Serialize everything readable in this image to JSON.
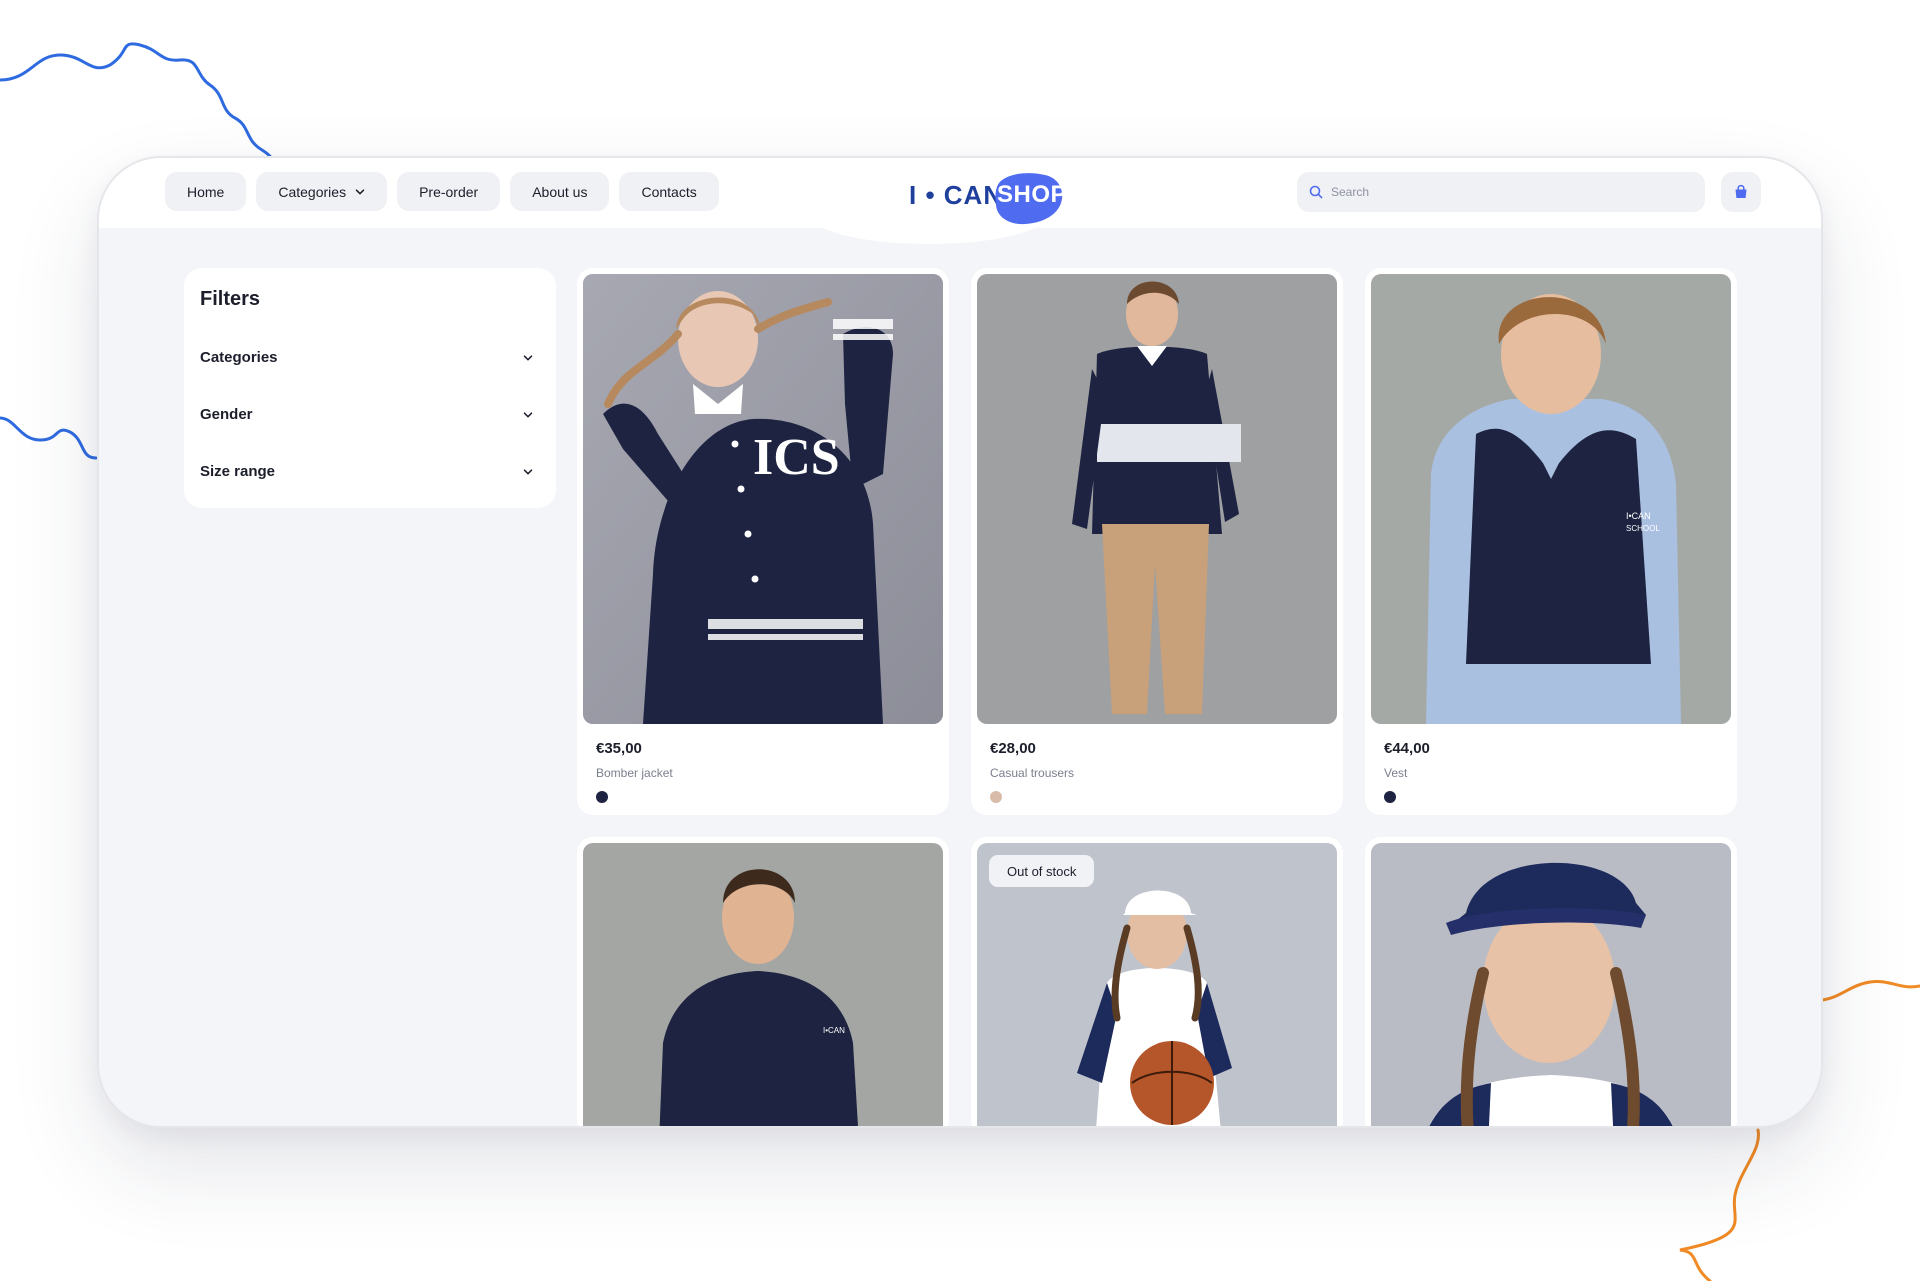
{
  "nav": {
    "home": "Home",
    "categories": "Categories",
    "preorder": "Pre-order",
    "about": "About us",
    "contacts": "Contacts"
  },
  "logo": {
    "left": "I • CAN",
    "right": "SHOP"
  },
  "search": {
    "placeholder": "Search",
    "value": ""
  },
  "filters": {
    "title": "Filters",
    "items": [
      {
        "label": "Categories"
      },
      {
        "label": "Gender"
      },
      {
        "label": "Size range"
      }
    ]
  },
  "products": [
    {
      "price": "€35,00",
      "name": "Bomber jacket",
      "color": "#1d2341"
    },
    {
      "price": "€28,00",
      "name": "Casual trousers",
      "color": "#d9bcaa"
    },
    {
      "price": "€44,00",
      "name": "Vest",
      "color": "#1d2341"
    },
    {
      "badge": ""
    },
    {
      "badge": "Out of stock"
    },
    {
      "badge": ""
    }
  ],
  "colors": {
    "accent": "#4f6bef",
    "navy": "#1d2a5c",
    "brand": "#1f3f9d",
    "wave_blue": "#2f6be0",
    "wave_orange": "#f08a24"
  },
  "icons": {
    "search": "search-icon",
    "cart": "shopping-bag-icon",
    "chevron": "chevron-down-icon"
  }
}
